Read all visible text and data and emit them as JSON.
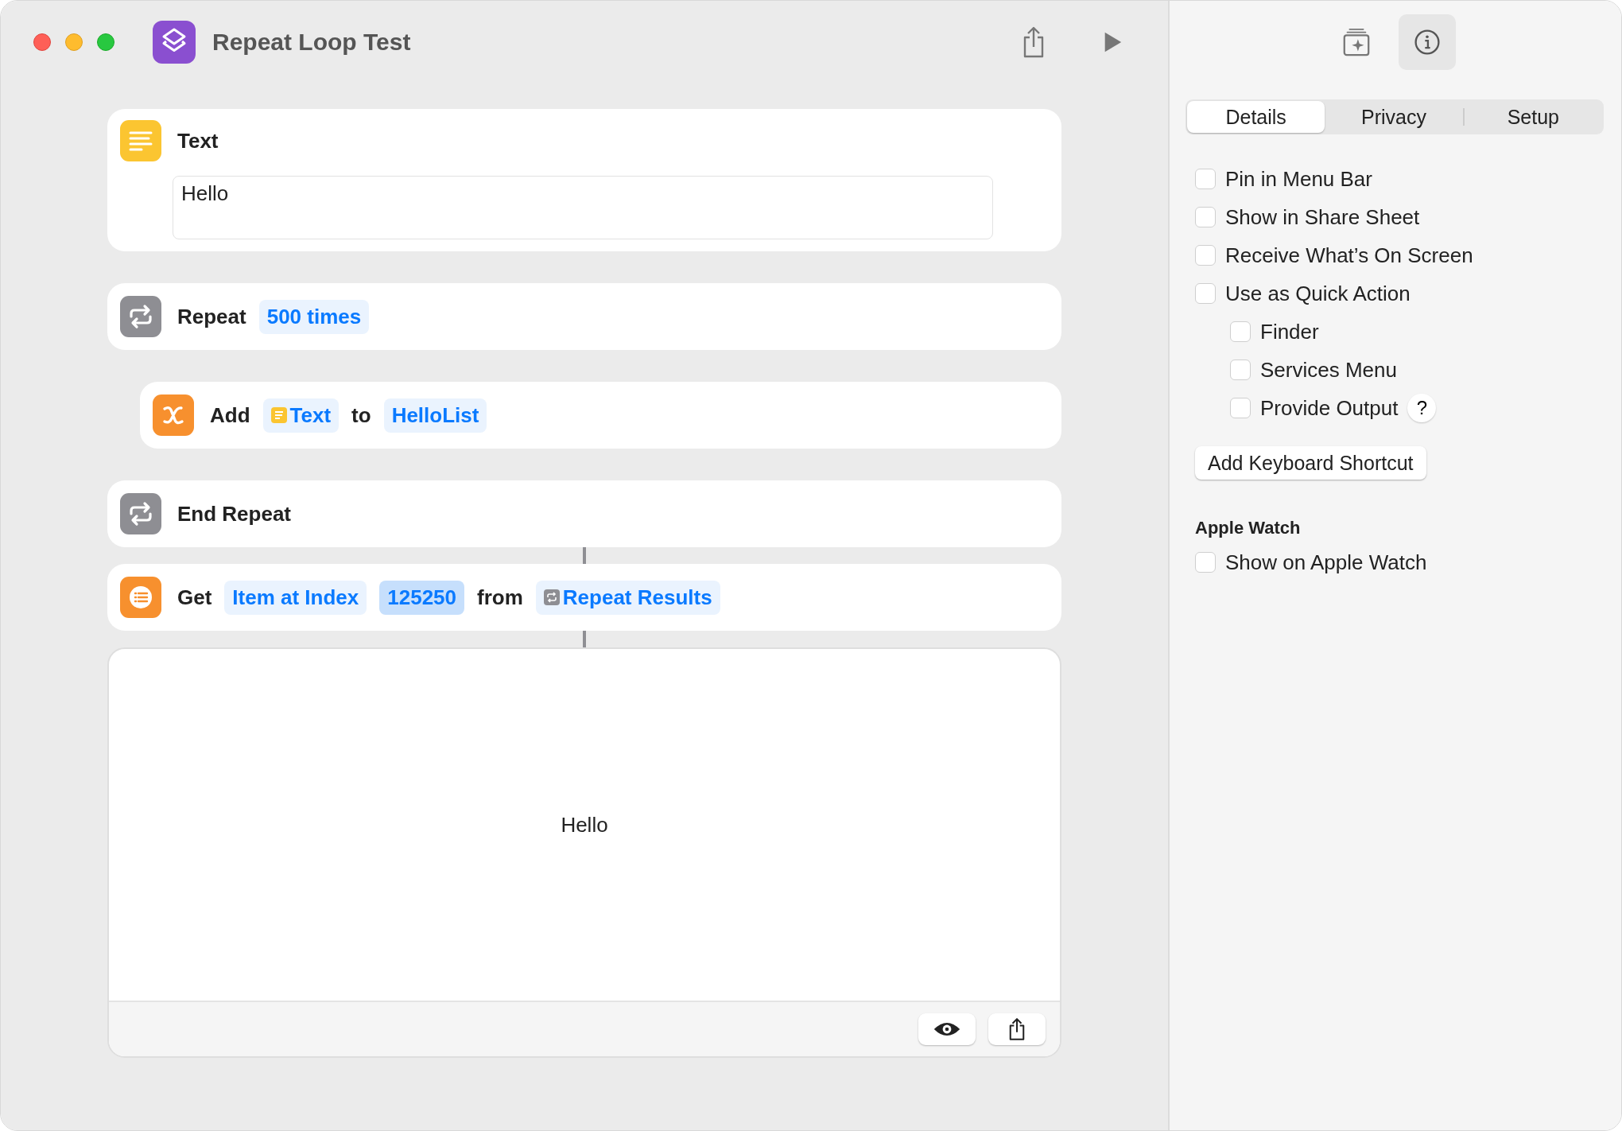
{
  "window": {
    "title": "Repeat Loop Test"
  },
  "actions": [
    {
      "kind": "text",
      "title": "Text",
      "value": "Hello"
    },
    {
      "kind": "repeat",
      "tokens": [
        {
          "kind": "label",
          "text": "Repeat"
        },
        {
          "kind": "param",
          "text": "500 times",
          "highlighted": false
        }
      ],
      "children": [
        {
          "kind": "add_variable",
          "tokens": [
            {
              "kind": "label",
              "text": "Add"
            },
            {
              "kind": "text_var",
              "text": "Text",
              "highlighted": false
            },
            {
              "kind": "label",
              "text": "to"
            },
            {
              "kind": "param",
              "text": "HelloList",
              "highlighted": false
            }
          ]
        }
      ]
    },
    {
      "kind": "end_repeat",
      "tokens": [
        {
          "kind": "label",
          "text": "End Repeat"
        }
      ]
    },
    {
      "kind": "get_item",
      "linked": true,
      "tokens": [
        {
          "kind": "label",
          "text": "Get"
        },
        {
          "kind": "param",
          "text": "Item at Index",
          "highlighted": false
        },
        {
          "kind": "param",
          "text": "125250",
          "highlighted": true
        },
        {
          "kind": "label",
          "text": "from"
        },
        {
          "kind": "repeat_var",
          "text": "Repeat Results",
          "highlighted": false
        }
      ]
    },
    {
      "kind": "result",
      "linked": true,
      "value": "Hello"
    }
  ],
  "sidebar": {
    "tabs": [
      {
        "label": "Details",
        "selected": true
      },
      {
        "label": "Privacy",
        "selected": false
      },
      {
        "label": "Setup",
        "selected": false
      }
    ],
    "options": [
      {
        "label": "Pin in Menu Bar",
        "checked": false
      },
      {
        "label": "Show in Share Sheet",
        "checked": false
      },
      {
        "label": "Receive What’s On Screen",
        "checked": false
      },
      {
        "label": "Use as Quick Action",
        "checked": false,
        "children": [
          {
            "label": "Finder",
            "checked": false
          },
          {
            "label": "Services Menu",
            "checked": false
          },
          {
            "label": "Provide Output",
            "checked": false,
            "help": "?"
          }
        ]
      }
    ],
    "shortcut_button": "Add Keyboard Shortcut",
    "sections": [
      {
        "heading": "Apple Watch",
        "options": [
          {
            "label": "Show on Apple Watch",
            "checked": false
          }
        ]
      }
    ]
  }
}
